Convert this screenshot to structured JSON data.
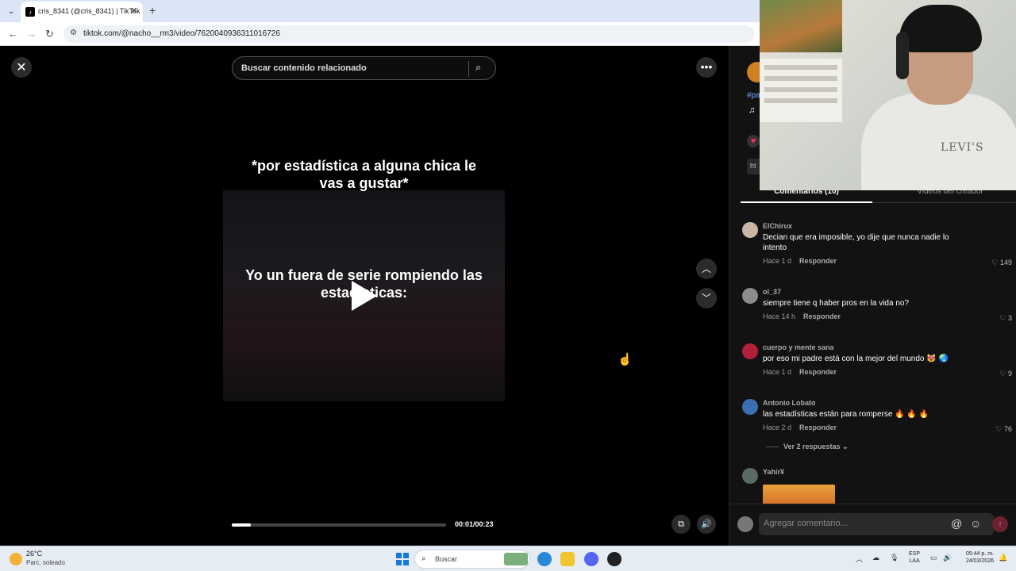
{
  "browser": {
    "tab_title": "cris_8341 (@cris_8341) | TikTok",
    "tab_close": "✕",
    "new_tab": "+",
    "url": "tiktok.com/@nacho__rm3/video/7620040936311016726"
  },
  "video": {
    "search_placeholder": "Buscar contenido relacionado",
    "caption_top": "*por estadística a alguna chica le vas a gustar*",
    "caption_mid": "Yo un fuera de serie rompiendo las estadísticas:",
    "time": "00:01/00:23",
    "progress_fraction": 0.09
  },
  "panel": {
    "hashtag": "#pa",
    "link_text": "ht",
    "tab_comments": "Comentarios (10)",
    "tab_creator_videos": "Videos del creador",
    "view_replies": "Ver 2 respuestas",
    "comment_placeholder": "Agregar comentario...",
    "reply_label": "Responder",
    "comments": [
      {
        "user": "ElChirux",
        "text": "Decian que era imposible, yo dije que nunca nadie lo intento",
        "time": "Hace 1 d",
        "likes": "149",
        "avatar_color": "#c9b7a6"
      },
      {
        "user": "ol_37",
        "text": "siempre tiene q haber pros en la vida no?",
        "time": "Hace 14 h",
        "likes": "3",
        "avatar_color": "#8c8c8c"
      },
      {
        "user": "cuerpo y mente sana",
        "text": "por eso mi padre está con la mejor del mundo 😻 🌏",
        "time": "Hace 1 d",
        "likes": "9",
        "avatar_color": "#b0203a"
      },
      {
        "user": "Antonio Lobato",
        "text": "las estadísticas están para romperse 🔥 🔥 🔥",
        "time": "Hace 2 d",
        "likes": "76",
        "avatar_color": "#3c6fb0"
      },
      {
        "user": "Yahir¥",
        "avatar_color": "#5a6a66"
      }
    ]
  },
  "taskbar": {
    "temperature": "26°C",
    "condition": "Parc. soleado",
    "search_label": "Buscar",
    "lang_line1": "ESP",
    "lang_line2": "LAA",
    "time": "05:44 p. m.",
    "date": "24/03/2026"
  },
  "webcam": {
    "shirt_logo": "LEVI'S"
  }
}
